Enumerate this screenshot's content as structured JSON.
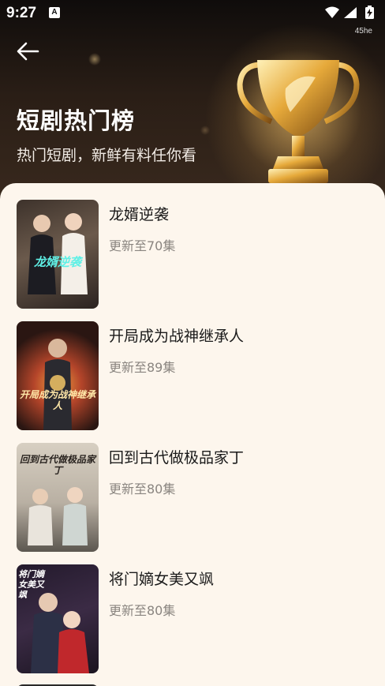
{
  "status_bar": {
    "time": "9:27",
    "notification_icon": "A",
    "sub_label": "45he",
    "icons": [
      "wifi-icon",
      "signal-icon",
      "battery-charging-icon"
    ]
  },
  "header": {
    "back_icon": "arrow-left-icon",
    "title": "短剧热门榜",
    "subtitle": "热门短剧，新鲜有料任你看",
    "decoration": "trophy-icon"
  },
  "dramas": [
    {
      "title": "龙婿逆袭",
      "status": "更新至70集",
      "cover_text": "龙婿逆袭",
      "cover_colors": [
        "#2b2320",
        "#6b5a4c"
      ],
      "cover_text_color": "#5ff0e6"
    },
    {
      "title": "开局成为战神继承人",
      "status": "更新至89集",
      "cover_text": "开局成为战神继承人",
      "cover_colors": [
        "#2a1612",
        "#b4452a"
      ],
      "cover_text_color": "#ffe7a8"
    },
    {
      "title": "回到古代做极品家丁",
      "status": "更新至80集",
      "cover_text": "回到古代做极品家丁",
      "cover_colors": [
        "#c9c1b4",
        "#5c5750"
      ],
      "cover_text_color": "#2a2420"
    },
    {
      "title": "将门嫡女美又飒",
      "status": "更新至80集",
      "cover_text": "将门嫡女美又飒",
      "cover_colors": [
        "#231a2c",
        "#a02a2e"
      ],
      "cover_text_color": "#ffffff"
    }
  ],
  "colors": {
    "panel_background": "#fdf6ed",
    "title_text": "#1a1a1a",
    "status_text": "#8a8580"
  }
}
